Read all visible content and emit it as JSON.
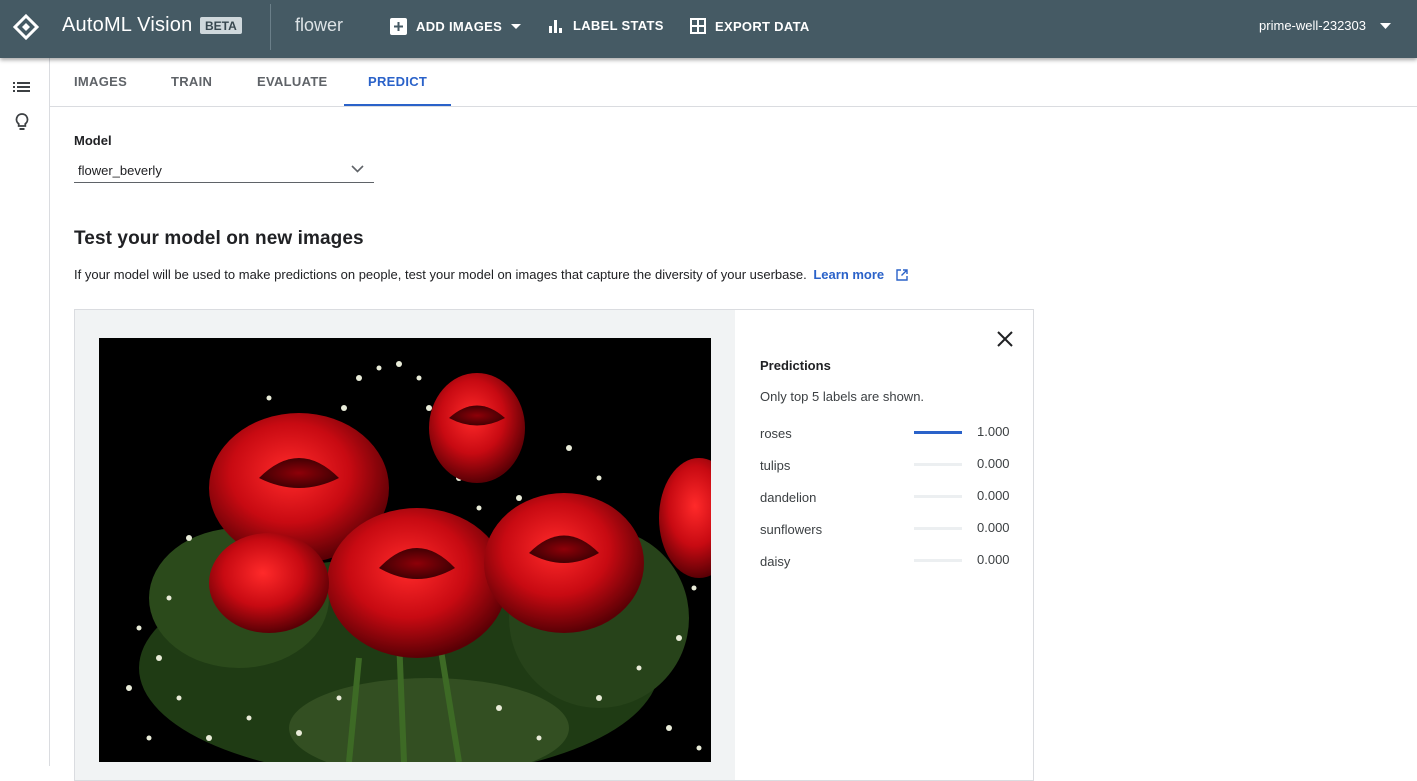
{
  "app": {
    "title": "AutoML Vision",
    "badge": "BETA",
    "dataset": "flower",
    "actions": [
      {
        "label": "ADD IMAGES",
        "icon": "add-box-icon"
      },
      {
        "label": "LABEL STATS",
        "icon": "bar-chart-icon"
      },
      {
        "label": "EXPORT DATA",
        "icon": "grid-icon"
      }
    ],
    "project": "prime-well-232303"
  },
  "rail": {
    "icons": [
      "list-icon",
      "lightbulb-icon"
    ]
  },
  "tabs": [
    {
      "label": "IMAGES",
      "active": false
    },
    {
      "label": "TRAIN",
      "active": false
    },
    {
      "label": "EVALUATE",
      "active": false
    },
    {
      "label": "PREDICT",
      "active": true
    }
  ],
  "model": {
    "label": "Model",
    "selected": "flower_beverly"
  },
  "test": {
    "title": "Test your model on new images",
    "description": "If your model will be used to make predictions on people, test your model on images that capture the diversity of your userbase.",
    "learn_more": "Learn more"
  },
  "predictions": {
    "title": "Predictions",
    "note": "Only top 5 labels are shown.",
    "items": [
      {
        "label": "roses",
        "score": "1.000",
        "value": 1.0
      },
      {
        "label": "tulips",
        "score": "0.000",
        "value": 0.0
      },
      {
        "label": "dandelion",
        "score": "0.000",
        "value": 0.0
      },
      {
        "label": "sunflowers",
        "score": "0.000",
        "value": 0.0
      },
      {
        "label": "daisy",
        "score": "0.000",
        "value": 0.0
      }
    ]
  },
  "colors": {
    "appbar": "#455a64",
    "accent": "#2a62c9",
    "rose": "#d0101a"
  }
}
